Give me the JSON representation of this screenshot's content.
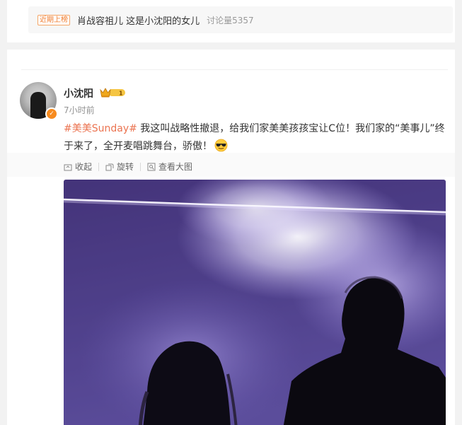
{
  "hot_topic": {
    "tag": "近期上榜",
    "title": "肖战容祖儿 这是小沈阳的女儿",
    "discussion": "讨论量5357"
  },
  "post": {
    "user": {
      "name": "小沈阳",
      "verified_icon": "v-badge-icon",
      "level_badge_icon": "crown-level-icon"
    },
    "time": "7小时前",
    "hashtag": "#美美Sunday#",
    "text": " 我这叫战略性撤退，给我们家美美孩孩宝让C位！我们家的“美事儿”终于来了，全开麦唱跳舞台，骄傲！",
    "emoji_icon": "sunglasses-emoji-icon",
    "actions": [
      {
        "label": "收起",
        "icon": "collapse-icon"
      },
      {
        "label": "旋转",
        "icon": "rotate-icon"
      },
      {
        "label": "查看大图",
        "icon": "view-large-icon"
      }
    ],
    "image_description_icon": "concert-photo"
  },
  "colors": {
    "hashtag": "#eb7350",
    "tag_border": "#f5a566",
    "background": "#f2f2f2"
  }
}
